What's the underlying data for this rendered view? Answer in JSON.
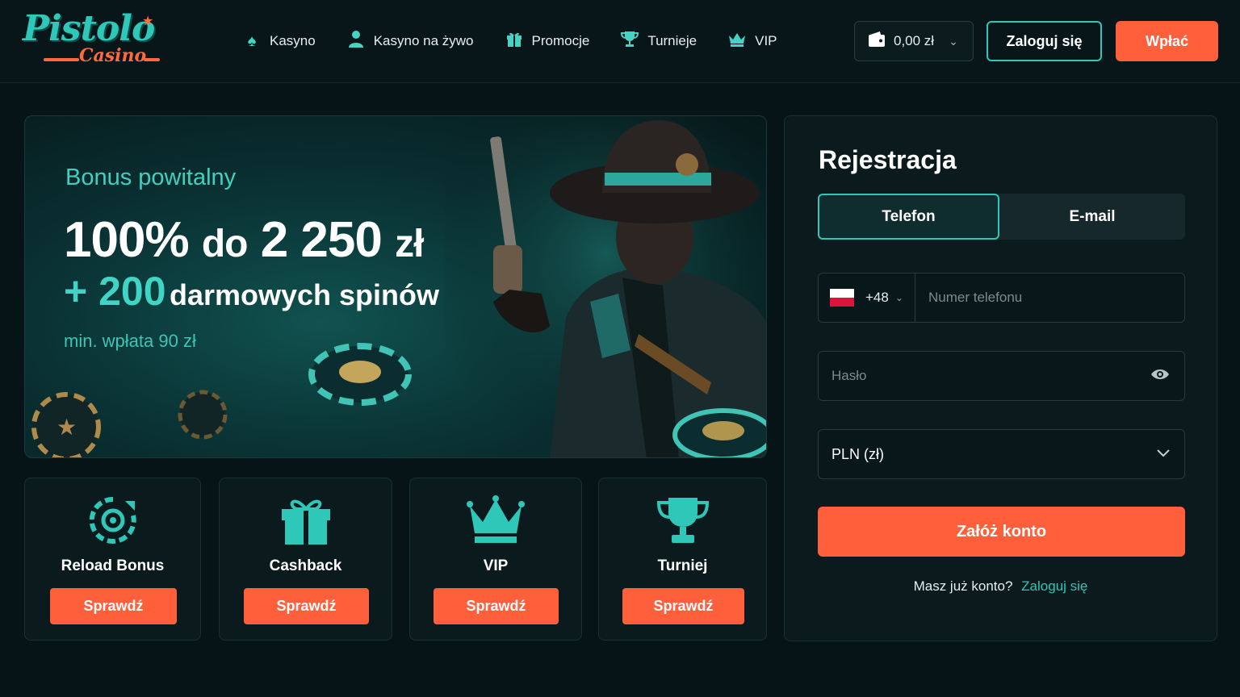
{
  "brand": {
    "name": "Pistolo",
    "sub": "Casino"
  },
  "colors": {
    "accent": "#2ec7b8",
    "cta": "#ff5f3a",
    "background": "#071417"
  },
  "nav": [
    {
      "label": "Kasyno",
      "icon": "spade-icon"
    },
    {
      "label": "Kasyno na żywo",
      "icon": "user-icon"
    },
    {
      "label": "Promocje",
      "icon": "gift-icon"
    },
    {
      "label": "Turnieje",
      "icon": "trophy-icon"
    },
    {
      "label": "VIP",
      "icon": "crown-icon"
    }
  ],
  "header": {
    "balance": "0,00 zł",
    "login_label": "Zaloguj się",
    "deposit_label": "Wpłać"
  },
  "hero": {
    "label": "Bonus powitalny",
    "percent": "100%",
    "amount_prefix": "do",
    "amount": "2 250",
    "currency": "zł",
    "spins_count": "+ 200",
    "spins_text": "darmowych spinów",
    "min_deposit": "min. wpłata 90 zł"
  },
  "cards": [
    {
      "title": "Reload Bonus",
      "icon": "reload-icon",
      "button": "Sprawdź"
    },
    {
      "title": "Cashback",
      "icon": "gift-icon",
      "button": "Sprawdź"
    },
    {
      "title": "VIP",
      "icon": "crown-icon",
      "button": "Sprawdź"
    },
    {
      "title": "Turniej",
      "icon": "trophy-icon",
      "button": "Sprawdź"
    }
  ],
  "registration": {
    "title": "Rejestracja",
    "tabs": [
      "Telefon",
      "E-mail"
    ],
    "active_tab": "Telefon",
    "phone_prefix": "+48",
    "phone_placeholder": "Numer telefonu",
    "password_placeholder": "Hasło",
    "currency_value": "PLN (zł)",
    "submit_label": "Załóż konto",
    "have_account_text": "Masz już konto?",
    "login_link": "Zaloguj się"
  }
}
